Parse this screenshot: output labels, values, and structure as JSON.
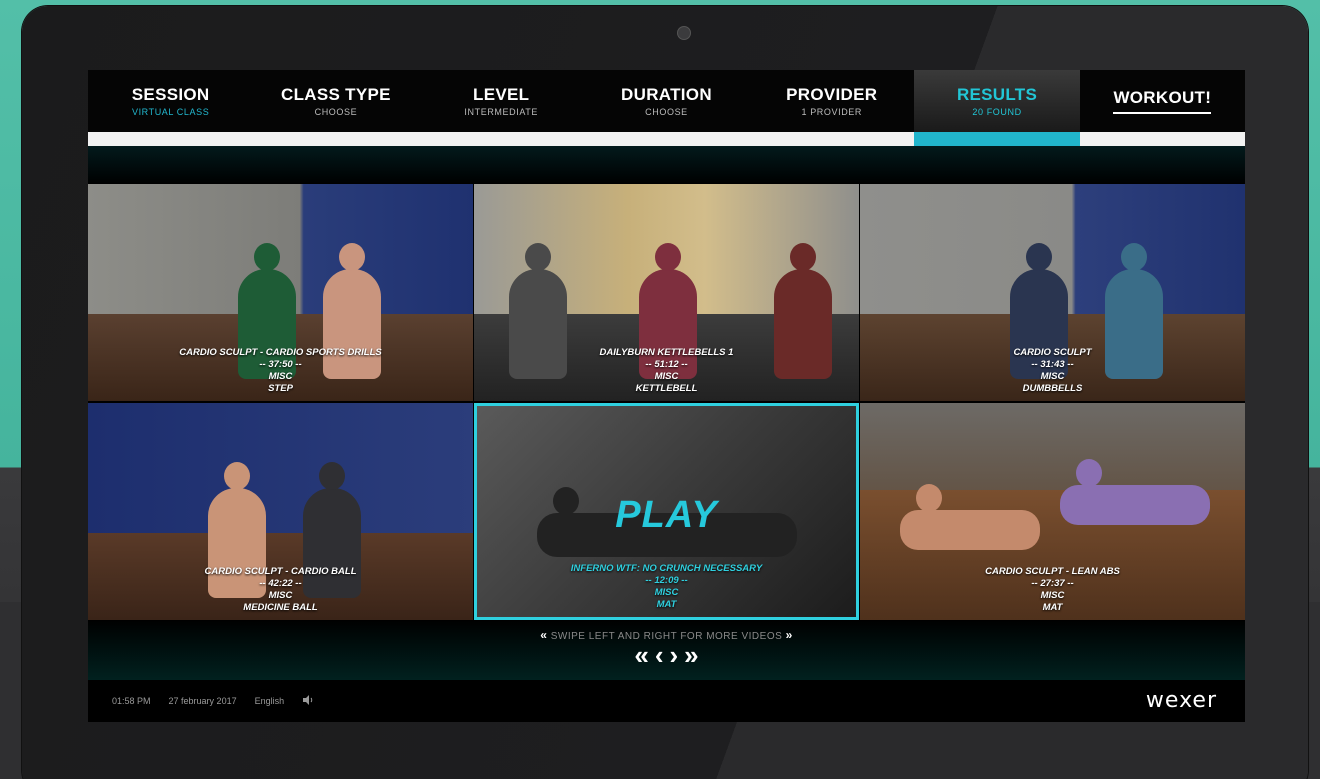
{
  "nav": [
    {
      "title": "SESSION",
      "sub": "VIRTUAL CLASS"
    },
    {
      "title": "CLASS TYPE",
      "sub": "CHOOSE"
    },
    {
      "title": "LEVEL",
      "sub": "INTERMEDIATE"
    },
    {
      "title": "DURATION",
      "sub": "CHOOSE"
    },
    {
      "title": "PROVIDER",
      "sub": "1 PROVIDER"
    },
    {
      "title": "RESULTS",
      "sub": "20 FOUND"
    },
    {
      "title": "WORKOUT!",
      "sub": ""
    }
  ],
  "videos": [
    {
      "name": "CARDIO SCULPT - CARDIO SPORTS DRILLS",
      "duration": "-- 37:50 --",
      "category": "MISC",
      "equipment": "STEP"
    },
    {
      "name": "DAILYBURN KETTLEBELLS 1",
      "duration": "-- 51:12 --",
      "category": "MISC",
      "equipment": "KETTLEBELL"
    },
    {
      "name": "CARDIO SCULPT",
      "duration": "-- 31:43 --",
      "category": "MISC",
      "equipment": "DUMBBELLS"
    },
    {
      "name": "CARDIO SCULPT - CARDIO BALL",
      "duration": "-- 42:22 --",
      "category": "MISC",
      "equipment": "MEDICINE BALL"
    },
    {
      "name": "INFERNO WTF: NO CRUNCH NECESSARY",
      "duration": "-- 12:09 --",
      "category": "MISC",
      "equipment": "MAT"
    },
    {
      "name": "CARDIO SCULPT - LEAN ABS",
      "duration": "-- 27:37 --",
      "category": "MISC",
      "equipment": "MAT"
    }
  ],
  "play_label": "PLAY",
  "swipe_hint": "SWIPE LEFT AND RIGHT FOR MORE VIDEOS",
  "pager": {
    "first": "«",
    "prev": "‹",
    "next": "›",
    "last": "»"
  },
  "footer": {
    "time": "01:58 PM",
    "date": "27 february 2017",
    "language": "English",
    "brand": "wexer"
  },
  "colors": {
    "accent": "#22c6d6",
    "selected_border": "#2fd0df"
  },
  "icons": {
    "volume": "speaker-icon"
  }
}
